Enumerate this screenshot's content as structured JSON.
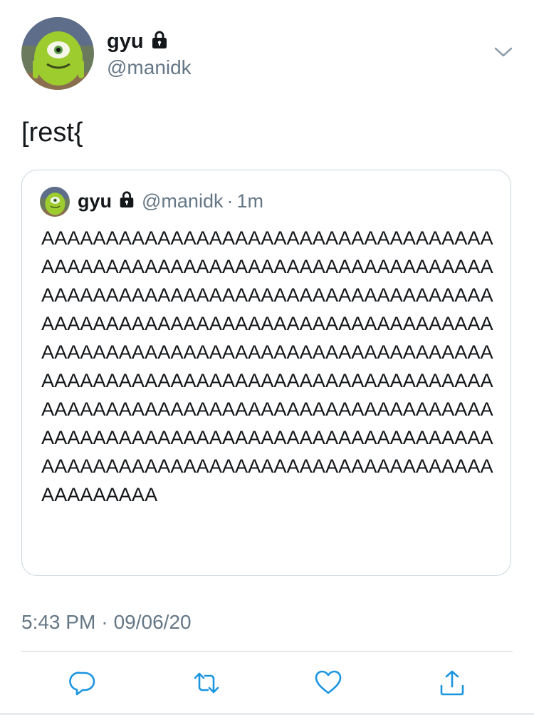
{
  "author": {
    "display_name": "gyu",
    "handle": "@manidk",
    "avatar_icon": "mike-wazowski-avatar",
    "lock_icon": "lock-icon"
  },
  "tweet": {
    "text": "[rest{"
  },
  "quoted_tweet": {
    "display_name": "gyu",
    "handle": "@manidk",
    "separator": "·",
    "time": "1m",
    "text": "AAAAAAAAAAAAAAAAAAAAAAAAAAAAAAAAAAAAAAAAAAAAAAAAAAAAAAAAAAAAAAAAAAAAAAAAAAAAAAAAAAAAAAAAAAAAAAAAAAAAAAAAAAAAAAAAAAAAAAAAAAAAAAAAAAAAAAAAAAAAAAAAAAAAAAAAAAAAAAAAAAAAAAAAAAAAAAAAAAAAAAAAAAAAAAAAAAAAAAAAAAAAAAAAAAAAAAAAAAAAAAAAAAAAAAAAAAAAAAAAAAAAAAAAAAAAAAAAAAAAAAAAAAAAAAAAAAAAAAAAAAAAAAAAAAAAAAAAAAAAAAAAAAAAAAAAAAAAAAAAAAAA"
  },
  "meta": {
    "time": "5:43 PM",
    "separator": "·",
    "date": "09/06/20"
  },
  "actions": [
    {
      "name": "reply",
      "icon": "reply-icon"
    },
    {
      "name": "retweet",
      "icon": "retweet-icon"
    },
    {
      "name": "like",
      "icon": "heart-icon"
    },
    {
      "name": "share",
      "icon": "share-icon"
    }
  ],
  "colors": {
    "text": "#14171a",
    "secondary": "#657786",
    "border": "#ccd6dd",
    "icon": "#1b95e0"
  }
}
